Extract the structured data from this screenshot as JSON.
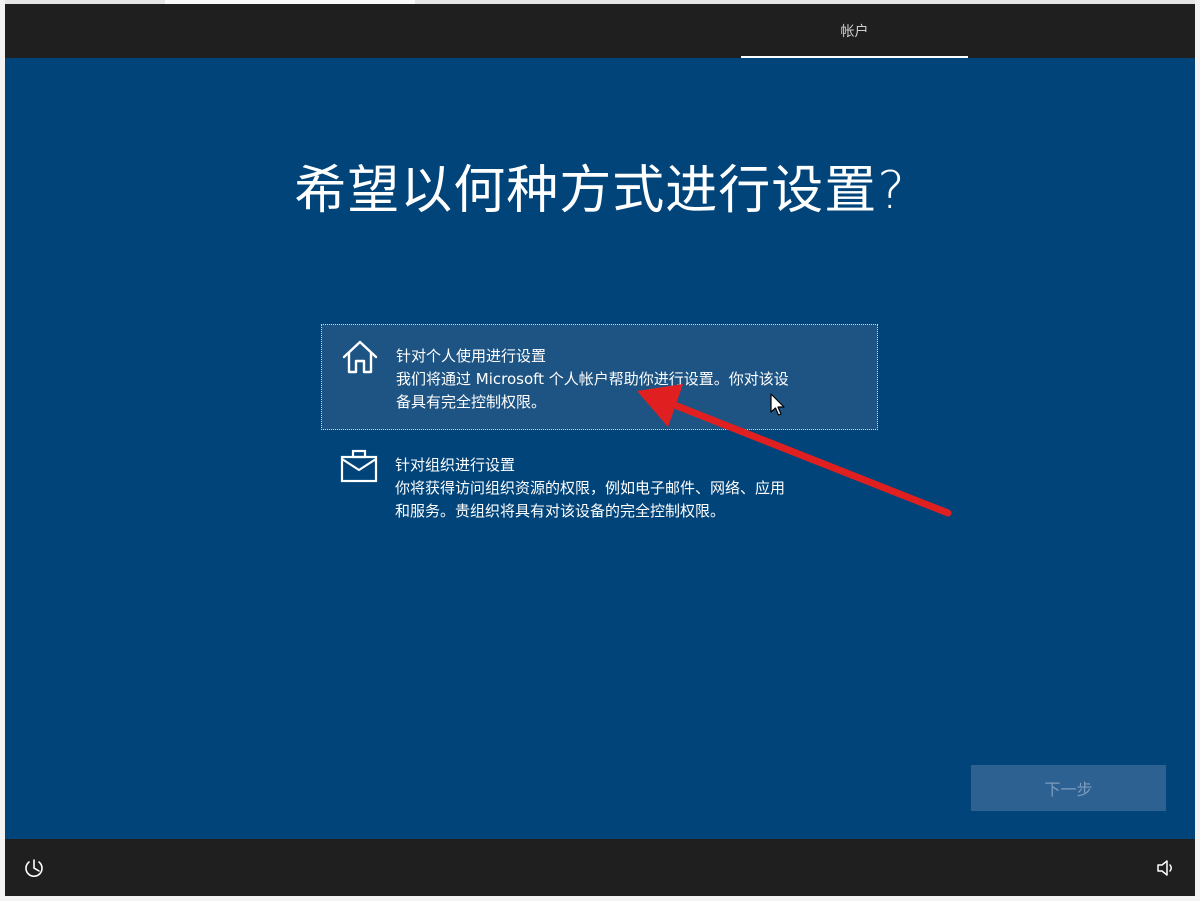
{
  "header": {
    "tab_label": "帐户"
  },
  "page": {
    "title": "希望以何种方式进行设置?"
  },
  "options": [
    {
      "title": "针对个人使用进行设置",
      "desc_lines": [
        "我们将通过 Microsoft 个人帐户帮助你进行设置。你对该设",
        "备具有完全控制权限。"
      ],
      "icon": "home-icon",
      "selected": true
    },
    {
      "title": "针对组织进行设置",
      "desc_lines": [
        "你将获得访问组织资源的权限，例如电子邮件、网络、应用",
        "和服务。贵组织将具有对该设备的完全控制权限。"
      ],
      "icon": "briefcase-icon",
      "selected": false
    }
  ],
  "next_button": {
    "label": "下一步",
    "enabled": false
  },
  "footer": {
    "left_icon": "accessibility-icon",
    "right_icon": "volume-icon"
  },
  "colors": {
    "background": "#00447a",
    "selected_option": "#1d5484",
    "chrome": "#1f1f1f",
    "annotation_arrow": "#e02020"
  }
}
